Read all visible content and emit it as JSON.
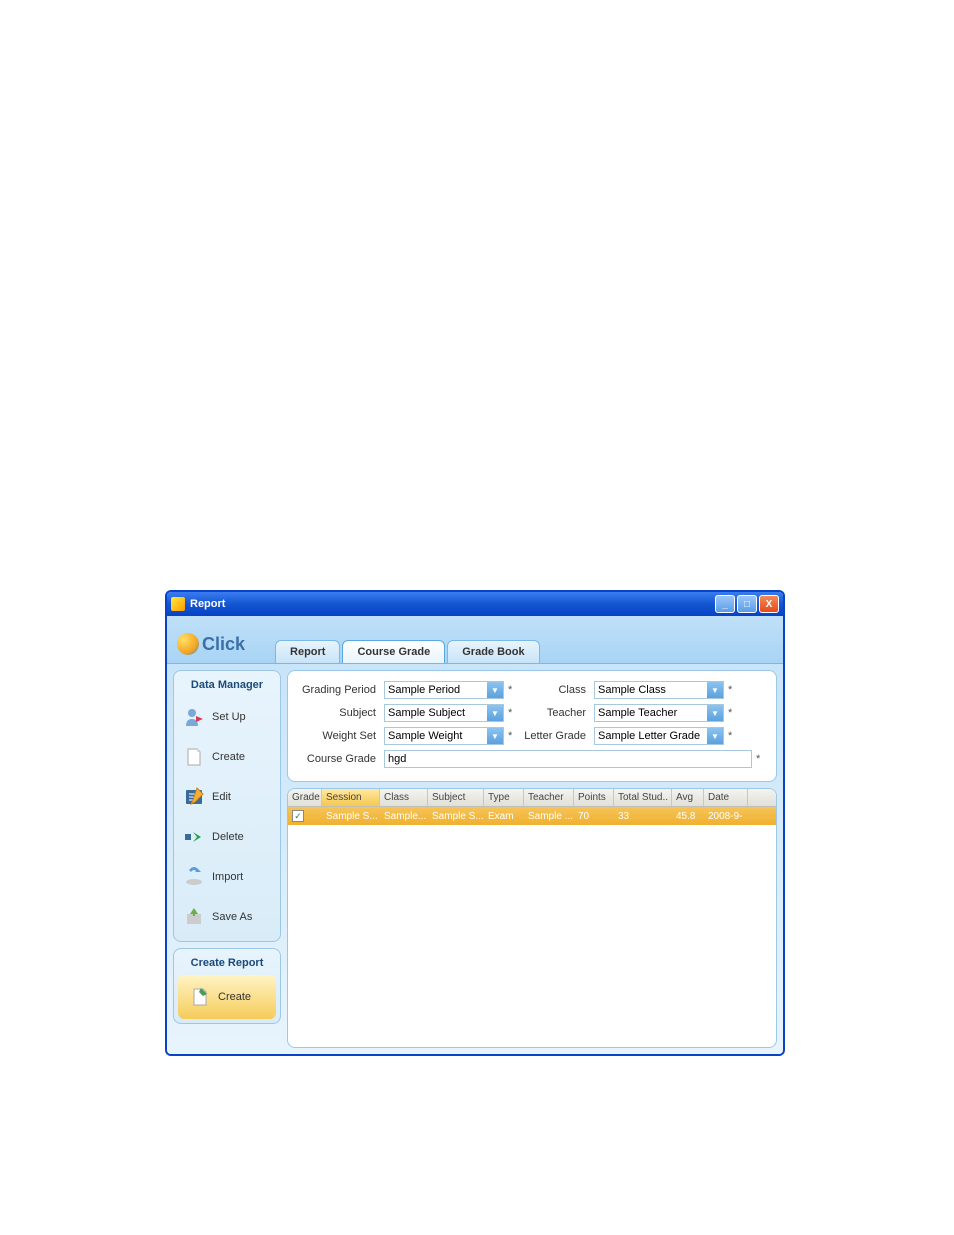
{
  "window": {
    "title": "Report"
  },
  "logo": {
    "text": "Click"
  },
  "tabs": [
    {
      "label": "Report"
    },
    {
      "label": "Course Grade"
    },
    {
      "label": "Grade Book"
    }
  ],
  "sidebar": {
    "data_manager": {
      "header": "Data Manager",
      "items": [
        {
          "label": "Set Up"
        },
        {
          "label": "Create"
        },
        {
          "label": "Edit"
        },
        {
          "label": "Delete"
        },
        {
          "label": "Import"
        },
        {
          "label": "Save As"
        }
      ]
    },
    "create_report": {
      "header": "Create Report",
      "button": "Create"
    }
  },
  "form": {
    "grading_period": {
      "label": "Grading Period",
      "value": "Sample Period",
      "req": "*"
    },
    "class": {
      "label": "Class",
      "value": "Sample Class",
      "req": "*"
    },
    "subject": {
      "label": "Subject",
      "value": "Sample Subject",
      "req": "*"
    },
    "teacher": {
      "label": "Teacher",
      "value": "Sample Teacher",
      "req": "*"
    },
    "weight_set": {
      "label": "Weight Set",
      "value": "Sample Weight",
      "req": "*"
    },
    "letter_grade": {
      "label": "Letter Grade",
      "value": "Sample Letter Grade",
      "req": "*"
    },
    "course_grade": {
      "label": "Course Grade",
      "value": "hgd",
      "req": "*"
    }
  },
  "grid": {
    "headers": {
      "grade": "Grade",
      "session": "Session",
      "class": "Class",
      "subject": "Subject",
      "type": "Type",
      "teacher": "Teacher",
      "points": "Points",
      "total_stud": "Total Stud..",
      "avg": "Avg",
      "date": "Date"
    },
    "rows": [
      {
        "checked": true,
        "session": "Sample S...",
        "class": "Sample...",
        "subject": "Sample S...",
        "type": "Exam",
        "teacher": "Sample ...",
        "points": "70",
        "total_stud": "33",
        "avg": "45.8",
        "date": "2008-9-"
      }
    ]
  }
}
